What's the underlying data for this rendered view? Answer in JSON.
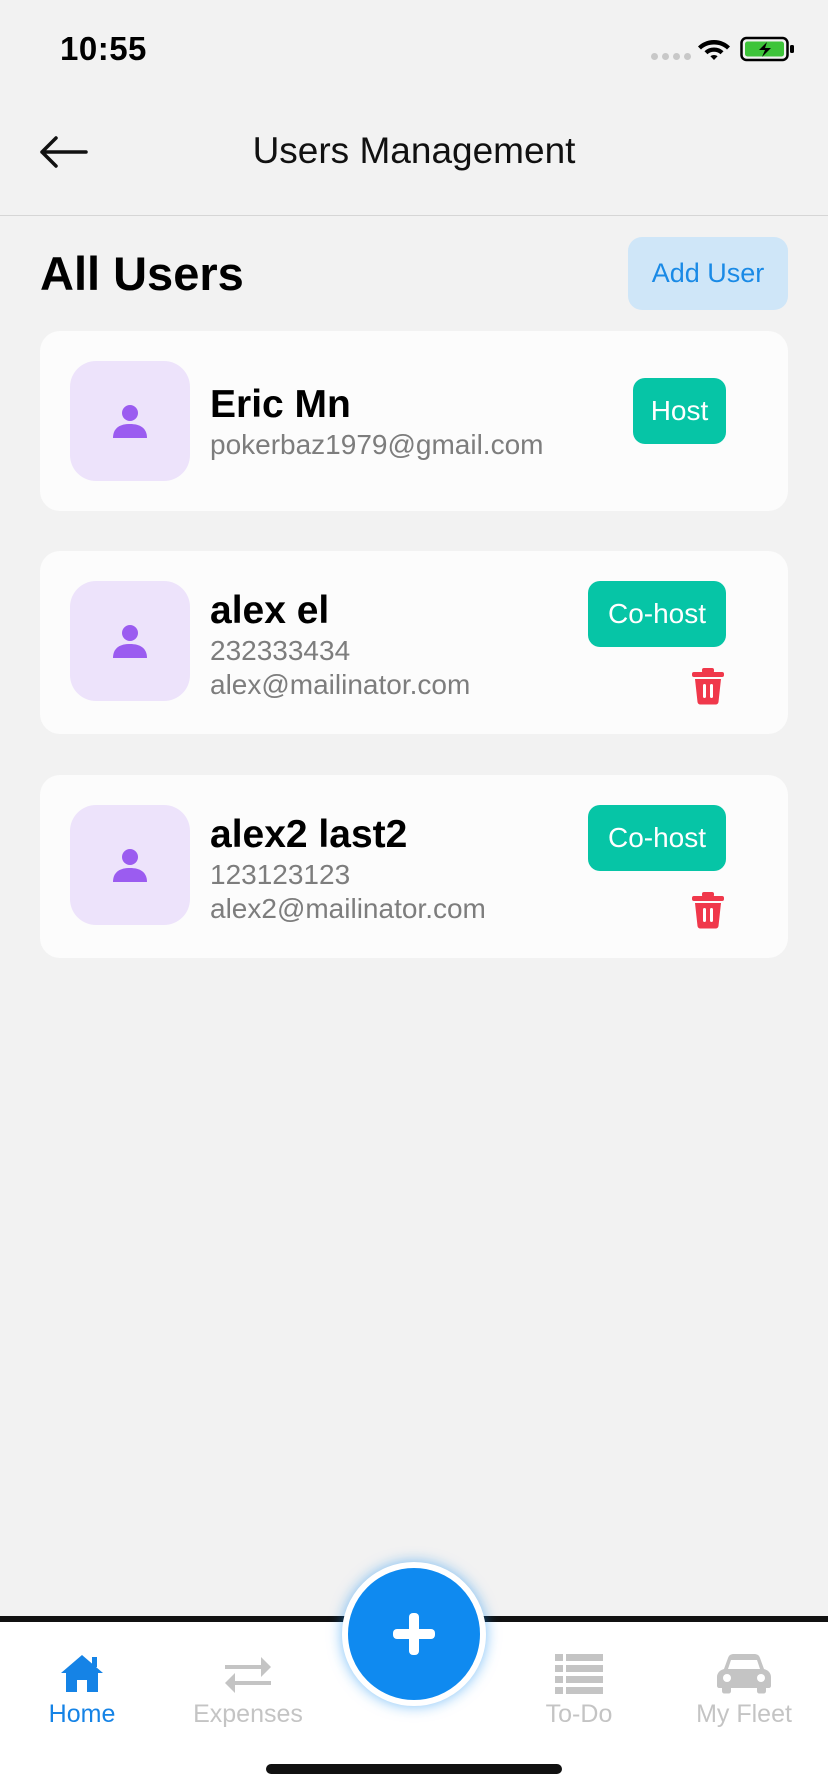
{
  "status_bar": {
    "time": "10:55"
  },
  "header": {
    "title": "Users Management"
  },
  "section": {
    "title": "All Users",
    "add_button_label": "Add User"
  },
  "users": [
    {
      "name": "Eric Mn",
      "phone": "",
      "email": "pokerbaz1979@gmail.com",
      "role": "Host",
      "deletable": false
    },
    {
      "name": "alex el",
      "phone": "232333434",
      "email": "alex@mailinator.com",
      "role": "Co-host",
      "deletable": true
    },
    {
      "name": "alex2 last2",
      "phone": "123123123",
      "email": "alex2@mailinator.com",
      "role": "Co-host",
      "deletable": true
    }
  ],
  "tabs": [
    {
      "label": "Home",
      "icon": "home-icon",
      "active": true
    },
    {
      "label": "Expenses",
      "icon": "arrows-exchange-icon",
      "active": false
    },
    {
      "label": "To-Do",
      "icon": "list-icon",
      "active": false
    },
    {
      "label": "My Fleet",
      "icon": "car-icon",
      "active": false
    }
  ],
  "colors": {
    "accent": "#0f8af0",
    "badge": "#06c5a6",
    "danger": "#f0384b",
    "avatar_bg": "#ede3fb",
    "avatar_icon": "#9b5cf0"
  }
}
